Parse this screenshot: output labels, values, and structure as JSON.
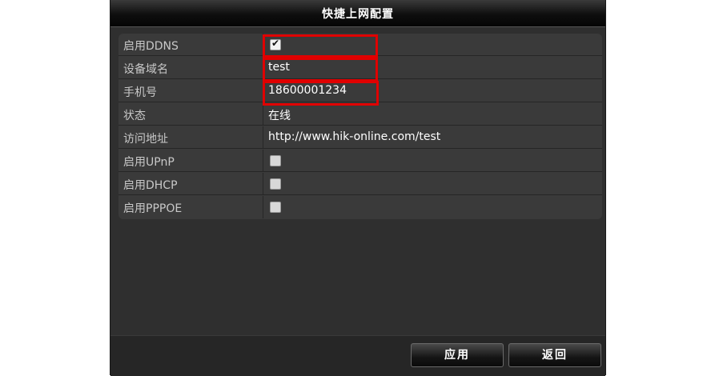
{
  "dialog": {
    "title": "快捷上网配置"
  },
  "rows": [
    {
      "label": "启用DDNS",
      "type": "checkbox",
      "checked": true
    },
    {
      "label": "设备域名",
      "type": "text",
      "value": "test"
    },
    {
      "label": "手机号",
      "type": "text",
      "value": "18600001234"
    },
    {
      "label": "状态",
      "type": "text",
      "value": "在线"
    },
    {
      "label": "访问地址",
      "type": "text",
      "value": "http://www.hik-online.com/test"
    },
    {
      "label": "启用UPnP",
      "type": "checkbox",
      "checked": false
    },
    {
      "label": "启用DHCP",
      "type": "checkbox",
      "checked": false
    },
    {
      "label": "启用PPPOE",
      "type": "checkbox",
      "checked": false
    }
  ],
  "buttons": {
    "apply": "应用",
    "back": "返回"
  },
  "colors": {
    "highlight": "#e00000",
    "background": "#2f2f2f"
  }
}
